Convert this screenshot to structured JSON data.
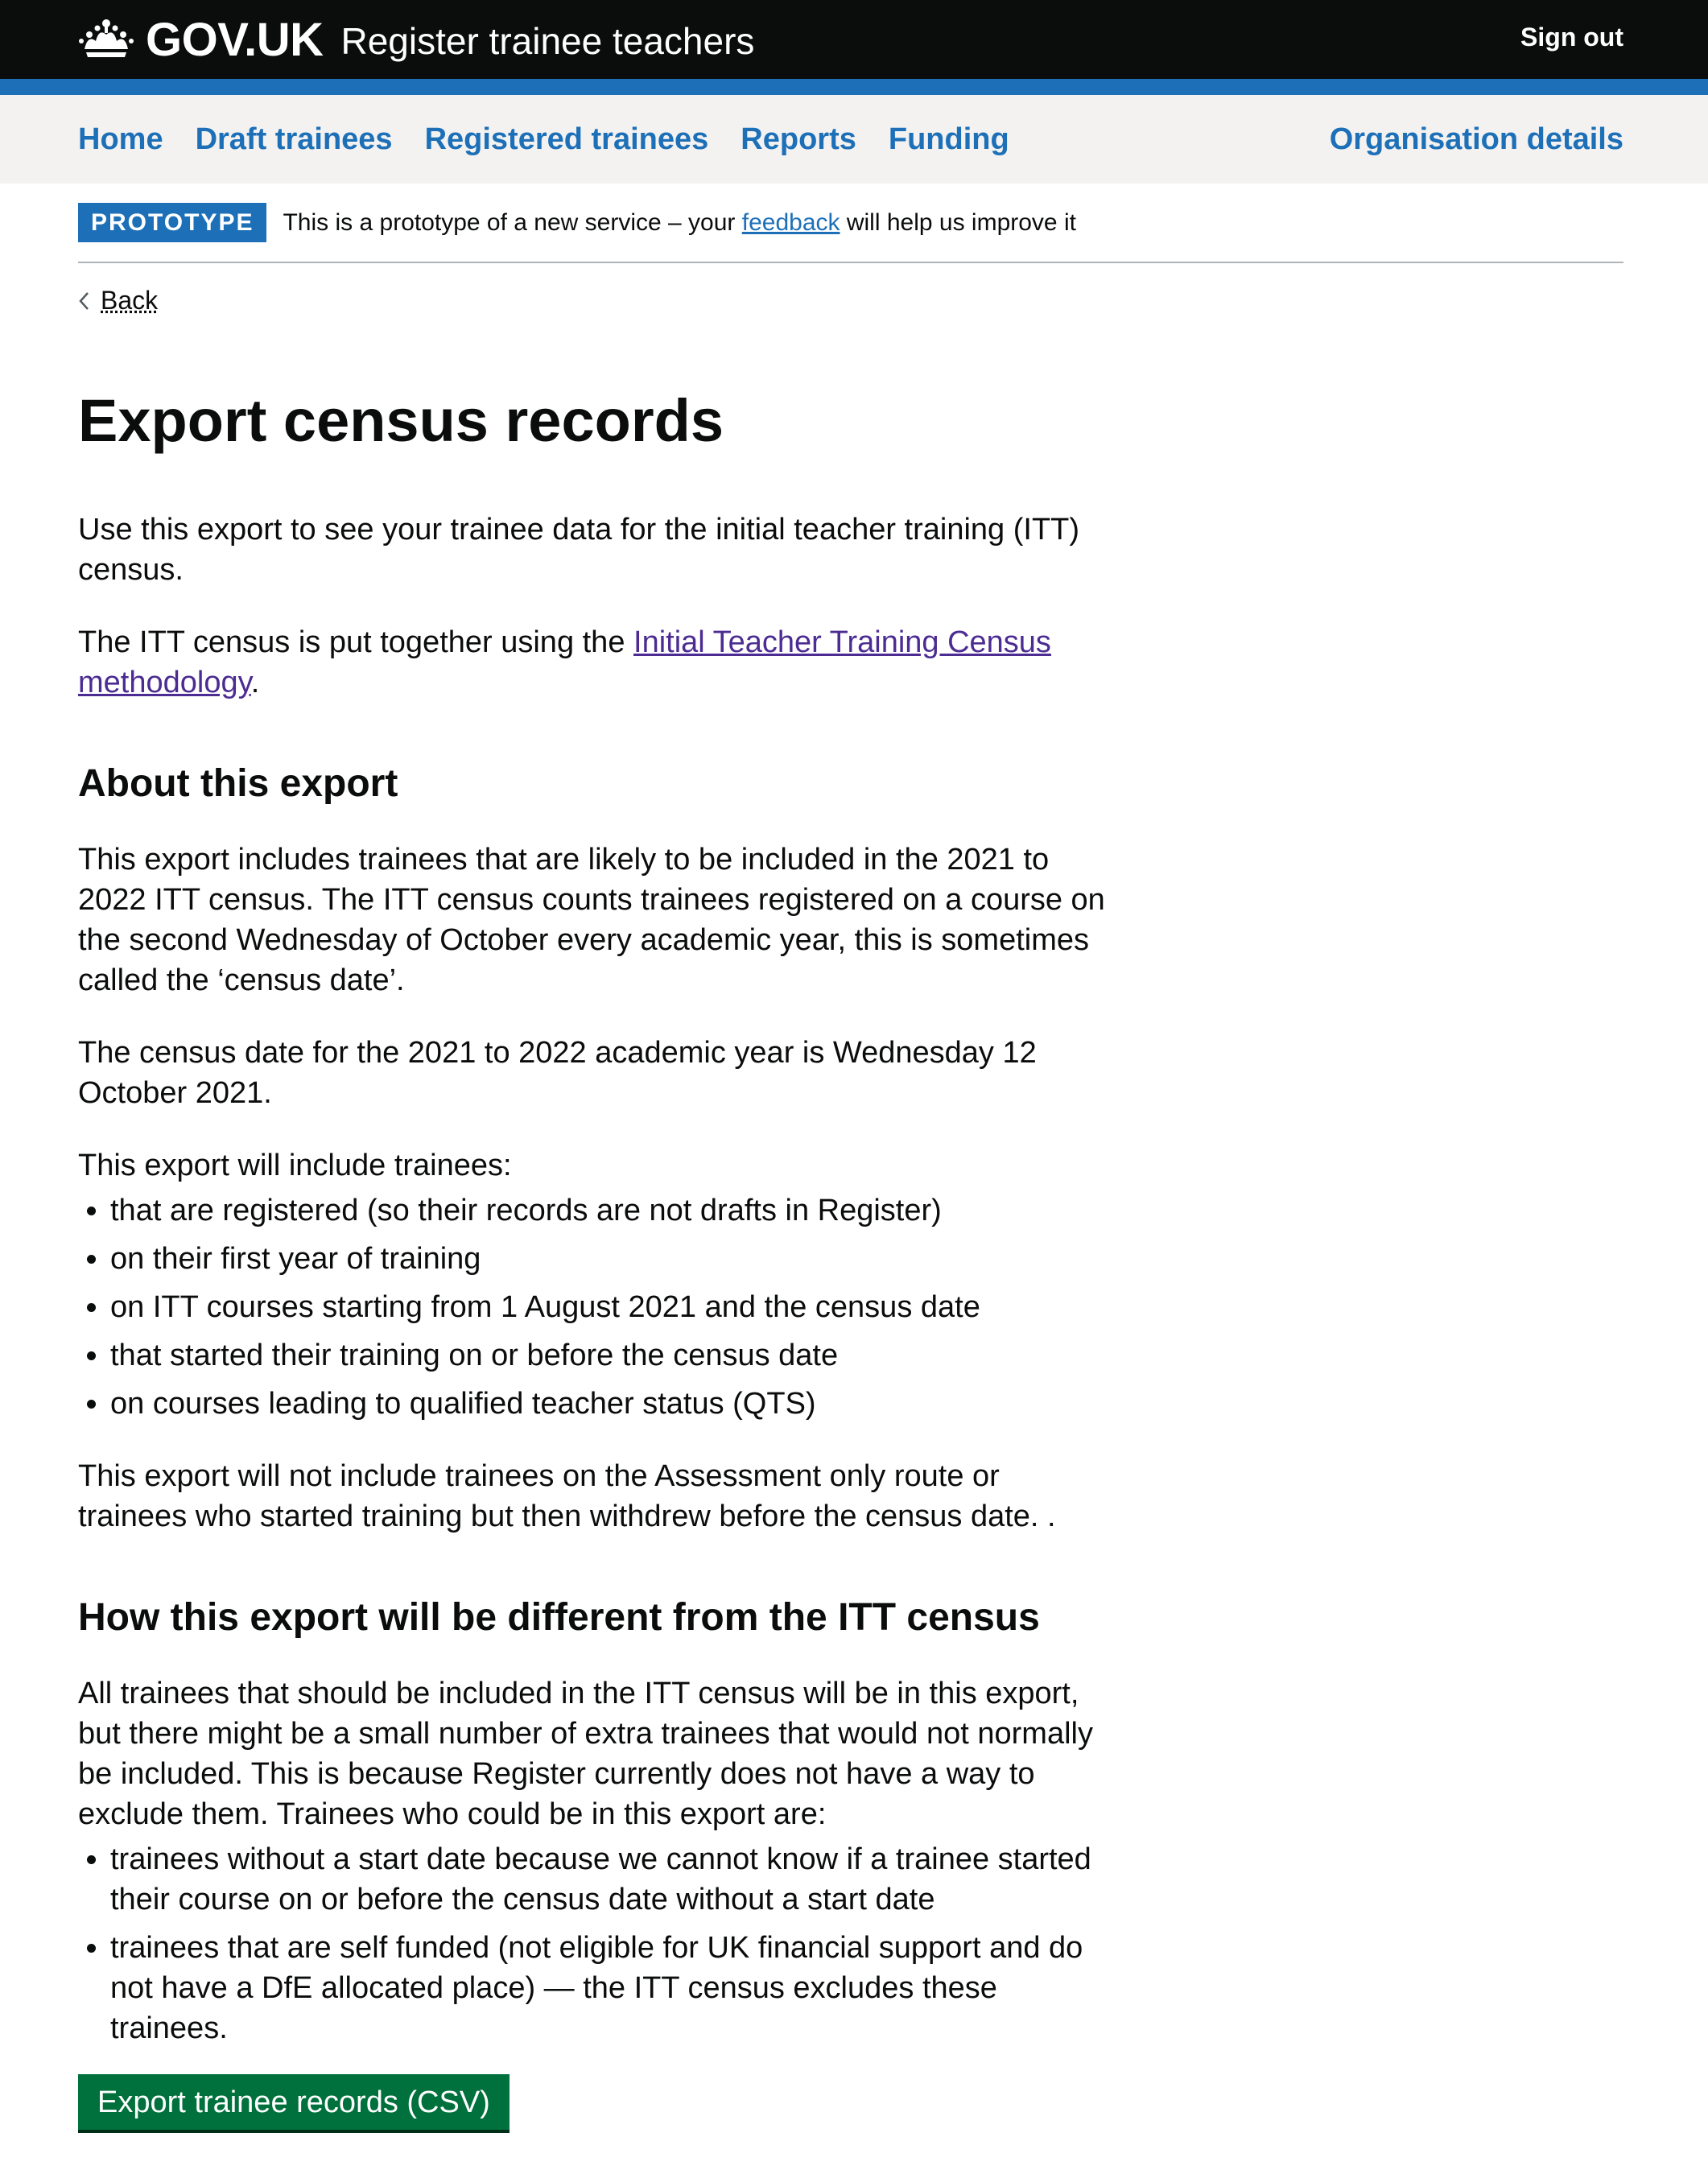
{
  "header": {
    "logo_text": "GOV.UK",
    "service_name": "Register trainee teachers",
    "sign_out": "Sign out",
    "crown_icon": "crown-icon"
  },
  "nav": {
    "items": [
      {
        "label": "Home"
      },
      {
        "label": "Draft trainees"
      },
      {
        "label": "Registered trainees"
      },
      {
        "label": "Reports"
      },
      {
        "label": "Funding"
      }
    ],
    "right_item": "Organisation details"
  },
  "phase_banner": {
    "tag": "PROTOTYPE",
    "text_before": "This is a prototype of a new service – your ",
    "link": "feedback",
    "text_after": " will help us improve it"
  },
  "back_link": "Back",
  "page": {
    "title": "Export census records",
    "intro": "Use this export to see your trainee data for the initial teacher training (ITT) census.",
    "methodology_before": "The ITT census is put together using the ",
    "methodology_link": "Initial Teacher Training Census methodology",
    "methodology_after": ".",
    "about_heading": "About this export",
    "about_p1": "This export includes trainees that are likely to be included in the 2021 to 2022 ITT census. The ITT census counts trainees registered on a course on the second Wednesday of October every academic year, this is sometimes called the ‘census date’.",
    "about_p2": "The census date for the 2021 to 2022 academic year is Wednesday 12 October 2021.",
    "include_intro": "This export will include trainees:",
    "include_items": [
      "that are registered (so their records are not drafts in Register)",
      "on their first year of training",
      "on ITT courses starting from 1 August 2021 and the census date",
      "that started their training on or before the census date",
      "on courses leading to qualified teacher status (QTS)"
    ],
    "exclude_text": "This export will not include trainees on the Assessment only route or trainees who started training but then withdrew before the census date. .",
    "diff_heading": "How this export will be different from the ITT census",
    "diff_p": "All trainees that should be included in the ITT census will be in this export, but there might be a small number of extra trainees that would not normally be included. This is because Register currently does not have a way to exclude them. Trainees who could be in this export are:",
    "diff_items": [
      "trainees without a start date because we cannot know if a trainee started their course on or before the census date without a start date",
      "trainees that are self funded (not eligible for UK financial support and do not have a DfE allocated place) — the ITT census excludes these trainees."
    ],
    "export_button": "Export trainee records (CSV)"
  },
  "colors": {
    "header_bg": "#0b0c0c",
    "brand_blue": "#1d70b8",
    "link_visited": "#4c2c92",
    "button_green": "#00703c",
    "nav_bg": "#f3f2f1"
  }
}
